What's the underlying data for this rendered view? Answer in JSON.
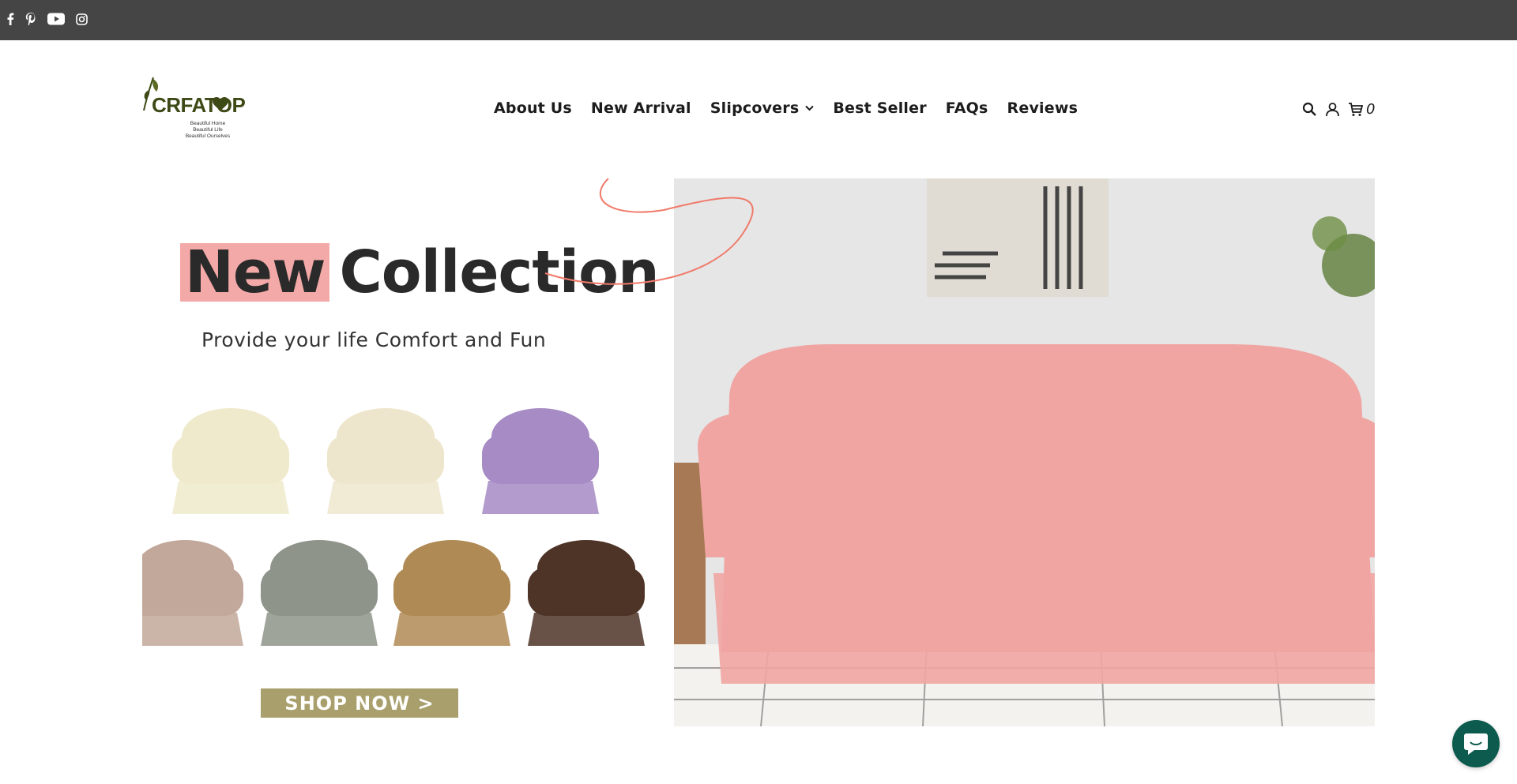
{
  "social": {
    "icons": [
      "facebook-icon",
      "pinterest-icon",
      "youtube-icon",
      "instagram-icon"
    ]
  },
  "logo": {
    "brand": "CRFATOP",
    "tagline": [
      "Beautiful Home",
      "Beautiful Life",
      "Beautiful Ourselves"
    ],
    "color": "#3d4a16"
  },
  "nav": {
    "items": [
      {
        "label": "About Us"
      },
      {
        "label": "New Arrival"
      },
      {
        "label": "Slipcovers"
      },
      {
        "label": "Best Seller"
      },
      {
        "label": "FAQs"
      },
      {
        "label": "Reviews"
      }
    ]
  },
  "header": {
    "cart_count": "0"
  },
  "hero": {
    "headline_new": "New",
    "headline_collection": "Collection",
    "subheadline": "Provide your life Comfort and Fun",
    "button_label": "SHOP NOW >",
    "chair_colors": [
      "#efeacb",
      "#eee6cc",
      "#a68bc4",
      "#c2a89a",
      "#8e948a",
      "#b08a55",
      "#4e3327"
    ],
    "sofa_color": "#f0a5a2",
    "accent_color": "#f3a9a7",
    "button_color": "#a99f6c"
  },
  "colors": {
    "topbar": "#454545",
    "chat": "#0d5b4e"
  }
}
